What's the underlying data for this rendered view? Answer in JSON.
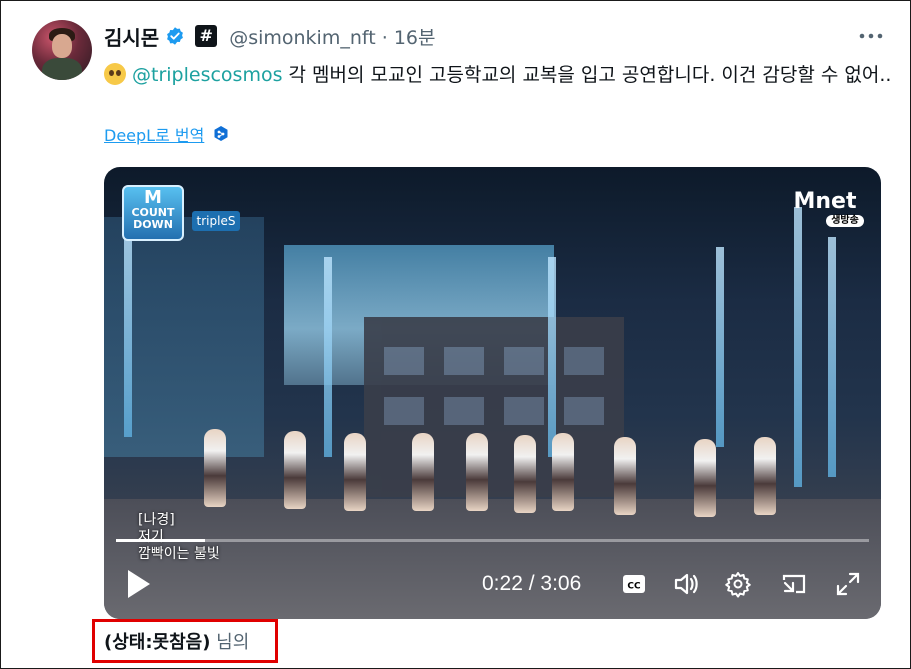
{
  "author": {
    "display_name": "김시몬",
    "handle": "@simonkim_nft",
    "separator": "·",
    "time": "16분",
    "badge_hash": "#"
  },
  "tweet": {
    "mention": "@triplescosmos",
    "text": " 각 멤버의 모교인 고등학교의 교복을 입고 공연합니다. 이건 감당할 수 없어.."
  },
  "translate": {
    "label": "DeepL로 번역"
  },
  "video": {
    "countdown_logo_top": "M",
    "countdown_logo_bottom": "COUNT DOWN",
    "group_tag": "tripleS",
    "channel_logo": "Mnet",
    "channel_sub": "생방송",
    "subtitle_lines": [
      "[나경]",
      "저기",
      "깜빡이는 불빛"
    ],
    "current_time": "0:22",
    "duration": "3:06",
    "time_separator": " / ",
    "progress_fraction": 0.118,
    "cc_label": "CC"
  },
  "status": {
    "bold": "(상태:못참음)",
    "rest": " 님의"
  },
  "colors": {
    "mention": "#1da1a0",
    "link": "#1d9bf0",
    "verified": "#1d9bf0",
    "highlight_box": "#e00000"
  }
}
